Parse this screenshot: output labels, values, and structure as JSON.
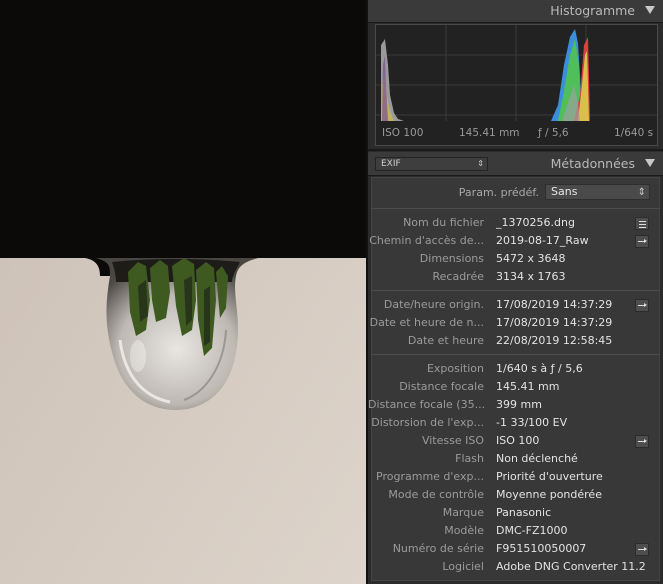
{
  "histogram": {
    "title": "Histogramme",
    "iso": "ISO 100",
    "focal": "145.41 mm",
    "aperture": "ƒ / 5,6",
    "shutter": "1/640 s"
  },
  "metadata": {
    "title": "Métadonnées",
    "preset_selector": "EXIF",
    "preset_label": "Param. prédéf.",
    "preset_value": "Sans",
    "rows": [
      {
        "label": "Nom du fichier",
        "value": "_1370256.dng"
      },
      {
        "label": "Chemin d'accès de...",
        "value": "2019-08-17_Raw"
      },
      {
        "label": "Dimensions",
        "value": "5472 x 3648"
      },
      {
        "label": "Recadrée",
        "value": "3134 x 1763"
      },
      {
        "label": "Date/heure origin.",
        "value": "17/08/2019 14:37:29"
      },
      {
        "label": "Date et heure de n...",
        "value": "17/08/2019 14:37:29"
      },
      {
        "label": "Date et heure",
        "value": "22/08/2019 12:58:45"
      },
      {
        "label": "Exposition",
        "value": "1/640 s à ƒ / 5,6"
      },
      {
        "label": "Distance focale",
        "value": "145.41 mm"
      },
      {
        "label": "Distance focale (35...",
        "value": "399 mm"
      },
      {
        "label": "Distorsion de l'exp...",
        "value": "-1 33/100 EV"
      },
      {
        "label": "Vitesse ISO",
        "value": "ISO 100"
      },
      {
        "label": "Flash",
        "value": "Non déclenché"
      },
      {
        "label": "Programme d'exp...",
        "value": "Priorité d'ouverture"
      },
      {
        "label": "Mode de contrôle",
        "value": "Moyenne pondérée"
      },
      {
        "label": "Marque",
        "value": "Panasonic"
      },
      {
        "label": "Modèle",
        "value": "DMC-FZ1000"
      },
      {
        "label": "Numéro de série",
        "value": "F951510050007"
      },
      {
        "label": "Logiciel",
        "value": "Adobe DNG Converter 11.2 ..."
      }
    ]
  }
}
